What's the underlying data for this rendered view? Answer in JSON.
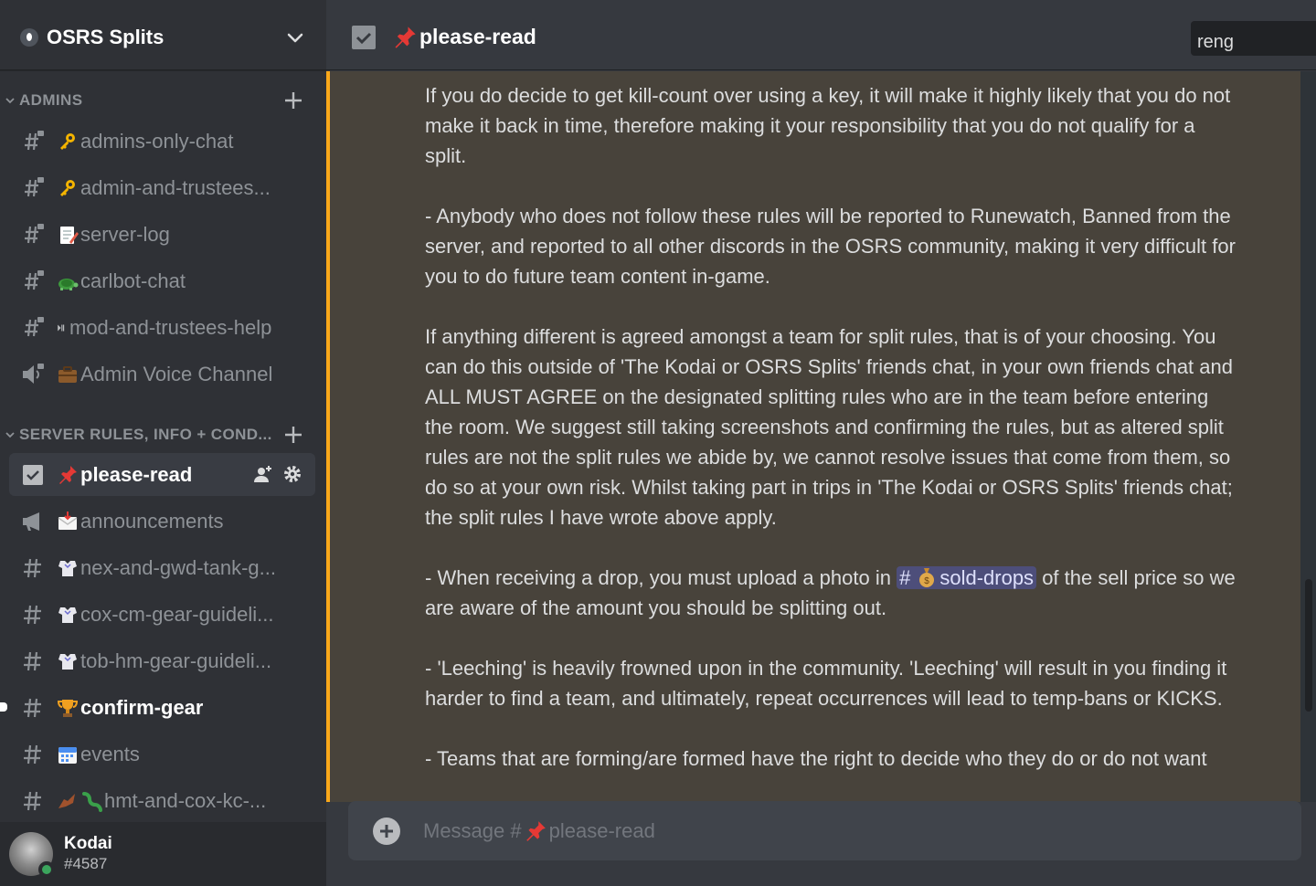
{
  "server": {
    "name": "OSRS Splits"
  },
  "categories": [
    {
      "label": "ADMINS"
    },
    {
      "label": "SERVER RULES, INFO + COND..."
    }
  ],
  "channels": [
    {
      "label": "admins-only-chat",
      "icon": "locked-hash-icon",
      "emoji": "key-emoji"
    },
    {
      "label": "admin-and-trustees...",
      "icon": "locked-hash-icon",
      "emoji": "key-emoji"
    },
    {
      "label": "server-log",
      "icon": "locked-hash-icon",
      "emoji": "memo-emoji"
    },
    {
      "label": "carlbot-chat",
      "icon": "locked-hash-icon",
      "emoji": "turtle-emoji"
    },
    {
      "label": "mod-and-trustees-help",
      "icon": "locked-hash-icon",
      "emoji": "play-pause-emoji"
    },
    {
      "label": "Admin Voice Channel",
      "icon": "locked-voice-icon",
      "emoji": "briefcase-emoji"
    },
    {
      "label": "please-read",
      "icon": "rules-icon",
      "emoji": "pushpin-emoji",
      "active": true
    },
    {
      "label": "announcements",
      "icon": "announcement-icon",
      "emoji": "envelope-emoji"
    },
    {
      "label": "nex-and-gwd-tank-g...",
      "icon": "hash-icon",
      "emoji": "armor-emoji"
    },
    {
      "label": "cox-cm-gear-guideli...",
      "icon": "hash-icon",
      "emoji": "armor-emoji"
    },
    {
      "label": "tob-hm-gear-guideli...",
      "icon": "hash-icon",
      "emoji": "armor-emoji"
    },
    {
      "label": "confirm-gear",
      "icon": "hash-icon",
      "emoji": "trophy-emoji",
      "unread": true
    },
    {
      "label": "events",
      "icon": "hash-icon",
      "emoji": "calendar-emoji"
    },
    {
      "label": "hmt-and-cox-kc-...",
      "icon": "hash-icon",
      "emoji": "lizard-emoji"
    }
  ],
  "user": {
    "name": "Kodai",
    "tag": "#4587",
    "status_color": "#3ba55d"
  },
  "topbar": {
    "channel_title": "please-read",
    "search_value": "reng"
  },
  "message": {
    "paragraphs": [
      "If you do decide to get kill-count over using a key, it will make it highly likely that you do not make it back in time, therefore making it your responsibility that you do not qualify for a split.",
      "- Anybody who does not follow these rules will be reported to Runewatch, Banned from the server, and reported to all other discords in the OSRS community, making it very difficult for you to do future team content in-game.",
      "If anything different is agreed amongst a team for split rules, that is of your choosing. You can do this outside of 'The Kodai or OSRS Splits' friends chat, in your own friends chat and ALL MUST AGREE on the designated splitting rules who are in the team before entering the room. We suggest still taking screenshots and confirming the rules, but as altered split rules are not the split rules we abide by, we cannot resolve issues that come from them, so do so at your own risk. Whilst taking part in trips in 'The Kodai or OSRS Splits' friends chat; the split rules I have wrote above apply."
    ],
    "drop_before": "- When receiving a drop, you must upload a photo in",
    "drop_mention": "sold-drops",
    "drop_after": "of the sell price so we are aware of the amount you should be splitting out.",
    "leeching": "- 'Leeching' is heavily frowned upon in the community. 'Leeching' will result in you finding it harder to find a team, and ultimately, repeat occurrences will lead to temp-bans or KICKS.",
    "teams": "- Teams that are forming/are formed have the right to decide who they do or do not want"
  },
  "composer": {
    "placeholder_prefix": "Message #",
    "placeholder_channel": "please-read"
  },
  "colors": {
    "accent": "#faa81a",
    "mention_bg": "#5865f2",
    "online": "#3ba55d",
    "highlight_bg": "#48433b"
  }
}
